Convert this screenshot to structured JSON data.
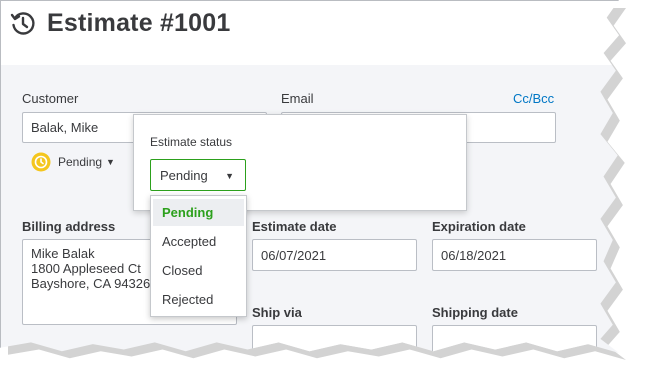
{
  "header": {
    "title": "Estimate #1001",
    "icon": "history-icon"
  },
  "customer": {
    "label": "Customer",
    "value": "Balak, Mike"
  },
  "email": {
    "label": "Email",
    "value": "",
    "ccbcc": "Cc/Bcc"
  },
  "status": {
    "current": "Pending",
    "popover_title": "Estimate status",
    "select_value": "Pending",
    "options": [
      "Pending",
      "Accepted",
      "Closed",
      "Rejected"
    ],
    "selected_option": "Pending"
  },
  "billing": {
    "label": "Billing address",
    "lines": [
      "Mike Balak",
      "1800 Appleseed Ct",
      "Bayshore, CA  94326"
    ]
  },
  "estimate_date": {
    "label": "Estimate date",
    "value": "06/07/2021"
  },
  "expiration_date": {
    "label": "Expiration date",
    "value": "06/18/2021"
  },
  "ship_via": {
    "label": "Ship via",
    "value": ""
  },
  "shipping_date": {
    "label": "Shipping date",
    "value": ""
  },
  "colors": {
    "accent_green": "#2ca01c",
    "link_blue": "#0077c5",
    "pending_yellow": "#f4c61e",
    "text": "#393a3d"
  }
}
